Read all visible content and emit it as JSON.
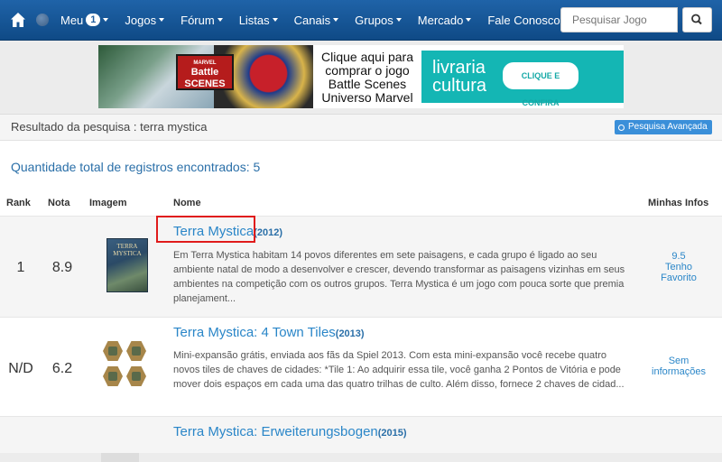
{
  "nav": {
    "menu": [
      {
        "label": "Meu",
        "badge": "1"
      },
      {
        "label": "Jogos"
      },
      {
        "label": "Fórum"
      },
      {
        "label": "Listas"
      },
      {
        "label": "Canais"
      },
      {
        "label": "Grupos"
      },
      {
        "label": "Mercado"
      },
      {
        "label": "Fale Conosco"
      }
    ],
    "search_placeholder": "Pesquisar Jogo",
    "colors": {
      "bar": "#1a5ba0",
      "accent": "#2a86c8"
    }
  },
  "banner": {
    "brand": "MARVEL",
    "logo": "Battle SCENES",
    "text": "Clique aqui para comprar o jogo Battle Scenes Universo Marvel",
    "store": "livraria cultura",
    "cta": "CLIQUE E CONFIRA"
  },
  "results": {
    "title": "Resultado da pesquisa : terra mystica",
    "advanced_button": "Pesquisa Avançada",
    "total": "Quantidade total de registros encontrados: 5",
    "columns": [
      "Rank",
      "Nota",
      "Imagem",
      "Nome",
      "Minhas Infos"
    ],
    "rows": [
      {
        "rank": "1",
        "nota": "8.9",
        "name": "Terra Mystica",
        "year": "(2012)",
        "box_text": "TERRA MYSTICA",
        "desc": "Em Terra Mystica habitam 14 povos diferentes em sete paisagens, e cada grupo é ligado ao seu ambiente natal de modo a desenvolver e crescer, devendo transformar as paisagens vizinhas em seus ambientes na competição com os outros grupos. Terra Mystica é um jogo com pouca sorte que premia planejament...",
        "info": [
          "9.5",
          "Tenho",
          "Favorito"
        ]
      },
      {
        "rank": "N/D",
        "nota": "6.2",
        "name": "Terra Mystica: 4 Town Tiles",
        "year": "(2013)",
        "desc": "Mini-expansão grátis, enviada aos fãs da Spiel 2013. Com esta mini-expansão você recebe quatro novos tiles de chaves de cidades: *Tile 1: Ao adquirir essa tile, você ganha 2 Pontos de Vitória e pode mover dois espaços em cada uma das quatro trilhas de culto. Além disso, fornece 2 chaves de cidad...",
        "info": [
          "Sem",
          "informações"
        ]
      },
      {
        "name": "Terra Mystica: Erweiterungsbogen",
        "year": "(2015)"
      }
    ]
  }
}
